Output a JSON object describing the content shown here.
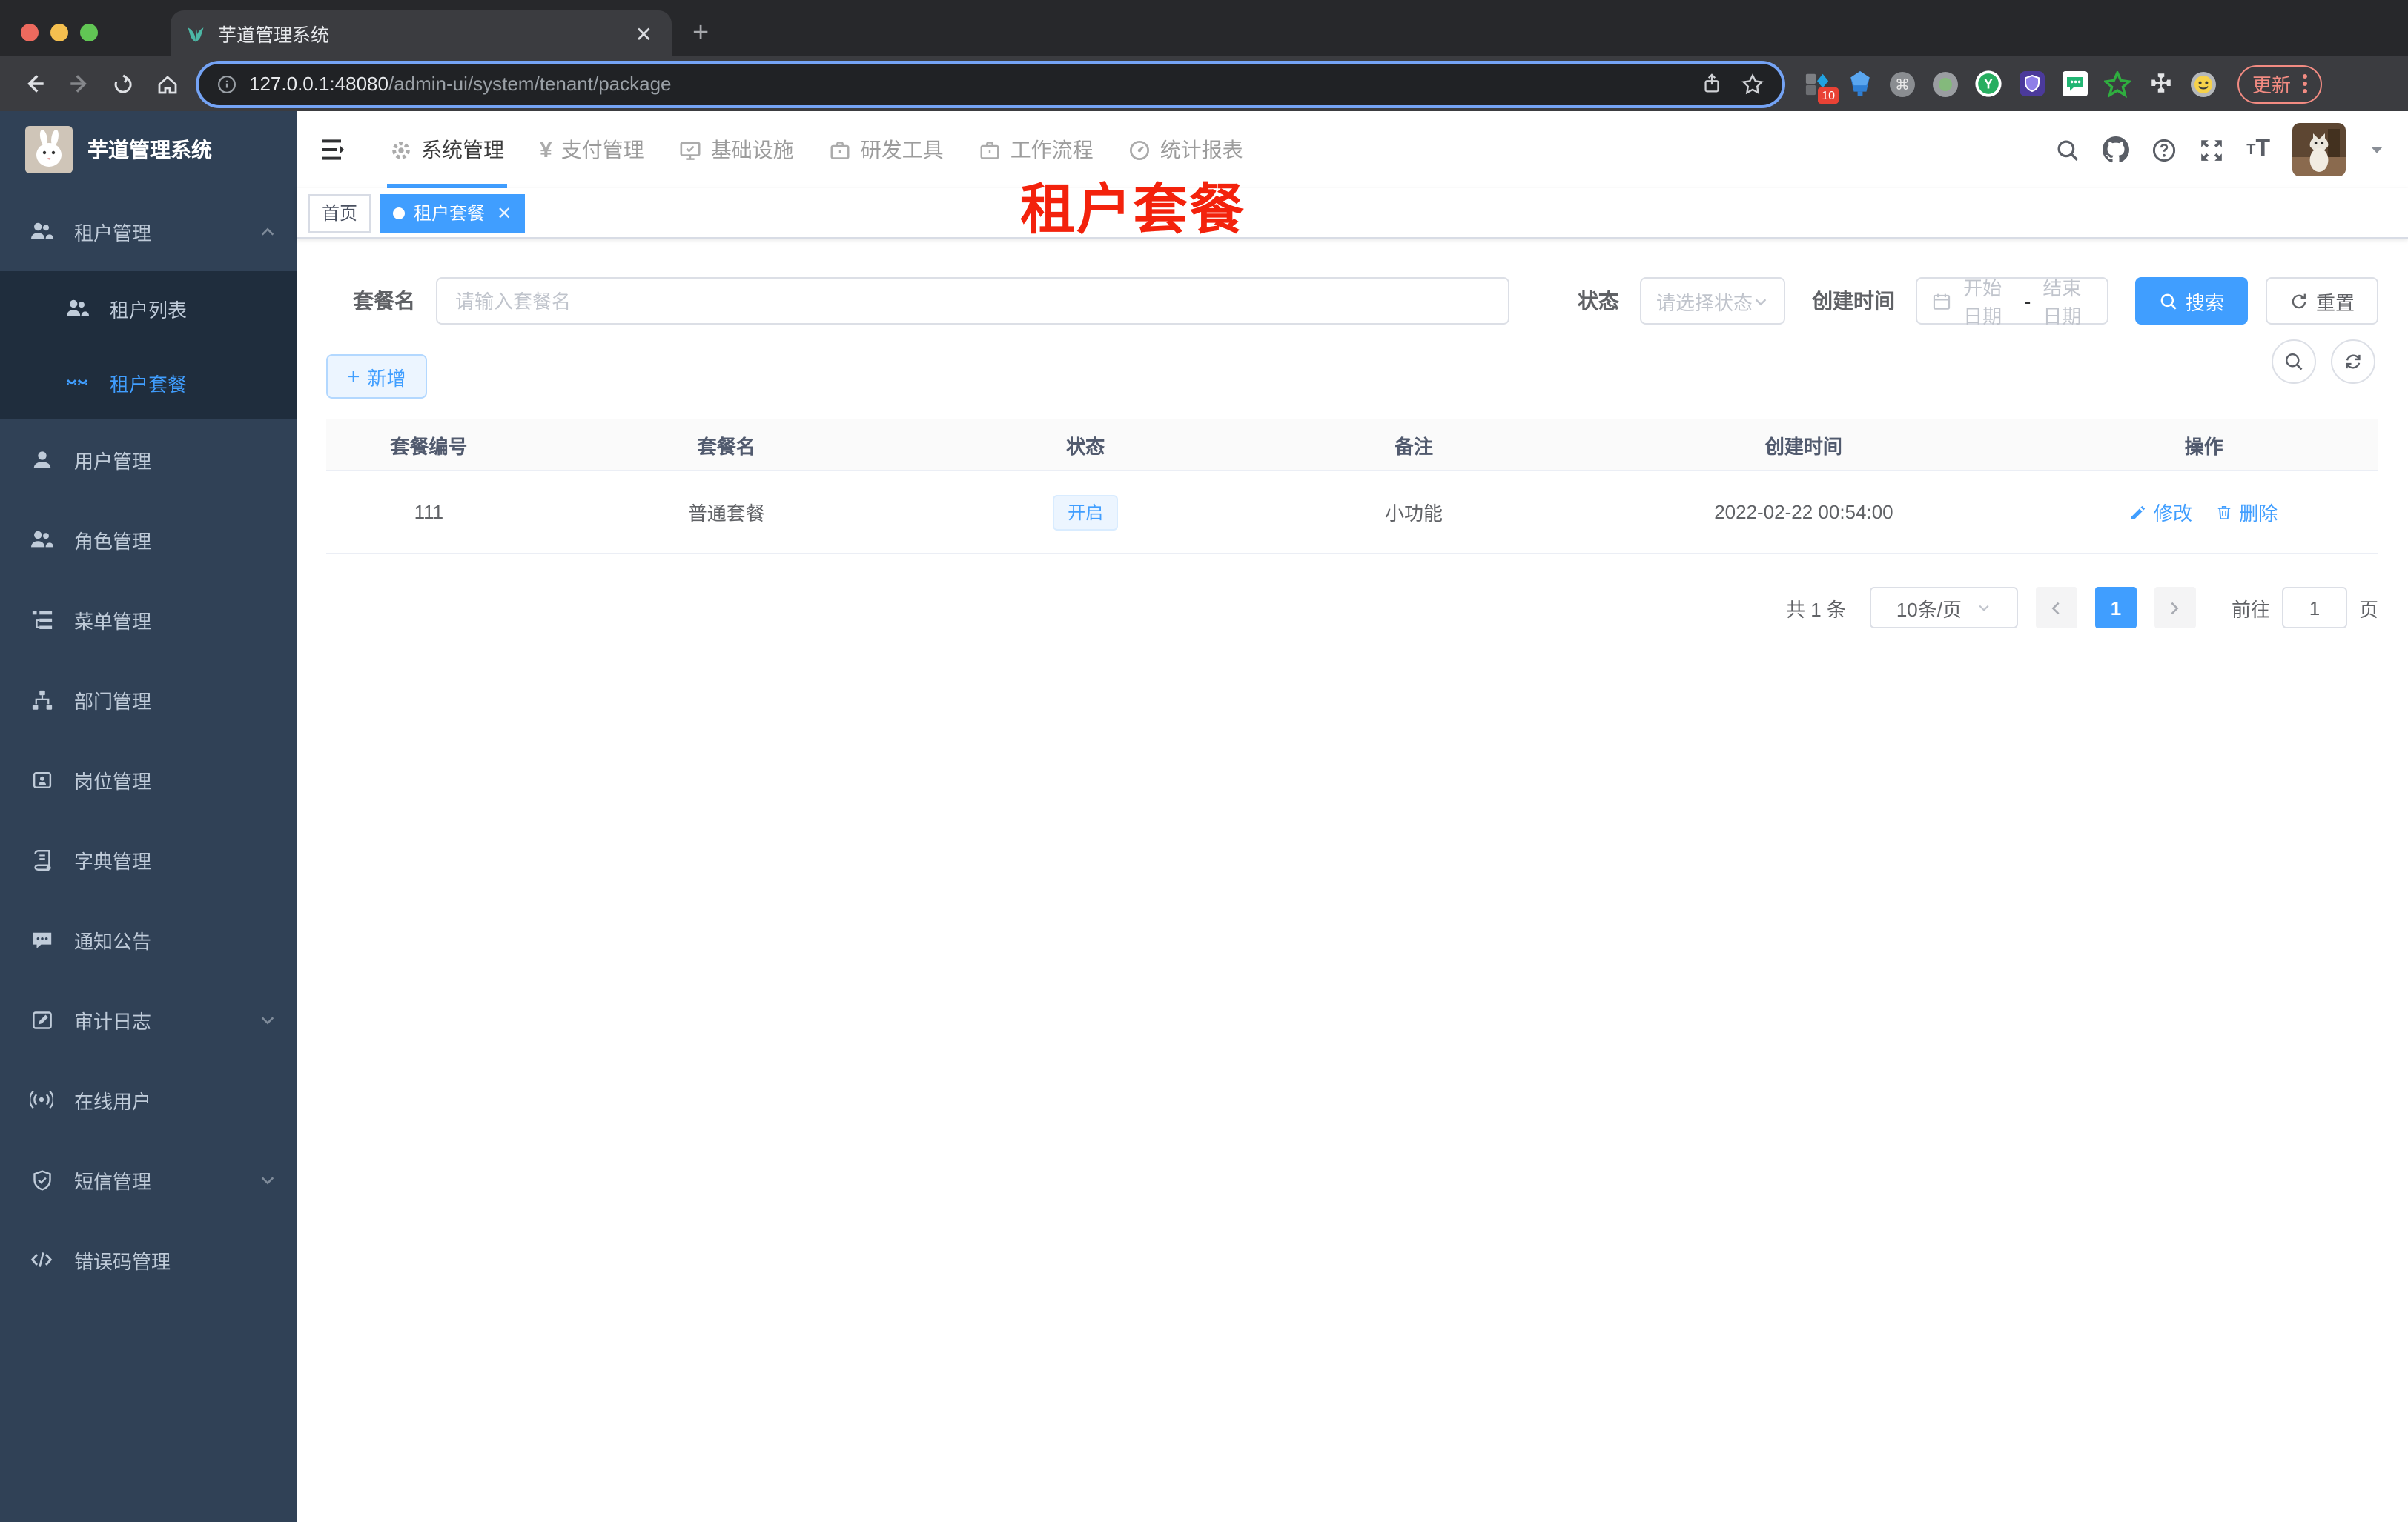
{
  "colors": {
    "accent": "#409eff",
    "overlay_red": "#f3220c",
    "update_pink": "#f28b82",
    "sidebar_bg": "#304156",
    "submenu_bg": "#1f2d3d",
    "sidebar_text": "#bfcbd9"
  },
  "browser": {
    "tab_title": "芋道管理系统",
    "url_host": "127.0.0.1:48080",
    "url_path": "/admin-ui/system/tenant/package",
    "extension_badge": "10",
    "update_label": "更新"
  },
  "app": {
    "logo_title": "芋道管理系统",
    "top_menu": {
      "items": [
        {
          "label": "系统管理"
        },
        {
          "label": "支付管理"
        },
        {
          "label": "基础设施"
        },
        {
          "label": "研发工具"
        },
        {
          "label": "工作流程"
        },
        {
          "label": "统计报表"
        }
      ]
    },
    "sidebar": {
      "items": [
        {
          "label": "租户管理"
        },
        {
          "label": "租户列表"
        },
        {
          "label": "租户套餐"
        },
        {
          "label": "用户管理"
        },
        {
          "label": "角色管理"
        },
        {
          "label": "菜单管理"
        },
        {
          "label": "部门管理"
        },
        {
          "label": "岗位管理"
        },
        {
          "label": "字典管理"
        },
        {
          "label": "通知公告"
        },
        {
          "label": "审计日志"
        },
        {
          "label": "在线用户"
        },
        {
          "label": "短信管理"
        },
        {
          "label": "错误码管理"
        }
      ]
    },
    "tags": {
      "home": "首页",
      "active": "租户套餐"
    },
    "overlay_title": "租户套餐",
    "filters": {
      "name_label": "套餐名",
      "name_placeholder": "请输入套餐名",
      "status_label": "状态",
      "status_placeholder": "请选择状态",
      "date_label": "创建时间",
      "date_start_placeholder": "开始日期",
      "date_separator": "-",
      "date_end_placeholder": "结束日期",
      "search_label": "搜索",
      "reset_label": "重置"
    },
    "actions_bar": {
      "add_label": "新增"
    },
    "table": {
      "headers": [
        "套餐编号",
        "套餐名",
        "状态",
        "备注",
        "创建时间",
        "操作"
      ],
      "rows": [
        {
          "id": "111",
          "name": "普通套餐",
          "status": "开启",
          "remark": "小功能",
          "created_at": "2022-02-22 00:54:00",
          "edit_label": "修改",
          "delete_label": "删除"
        }
      ]
    },
    "pagination": {
      "total": "共 1 条",
      "page_size": "10条/页",
      "current_page": "1",
      "goto_label": "前往",
      "goto_value": "1",
      "page_unit": "页"
    }
  }
}
